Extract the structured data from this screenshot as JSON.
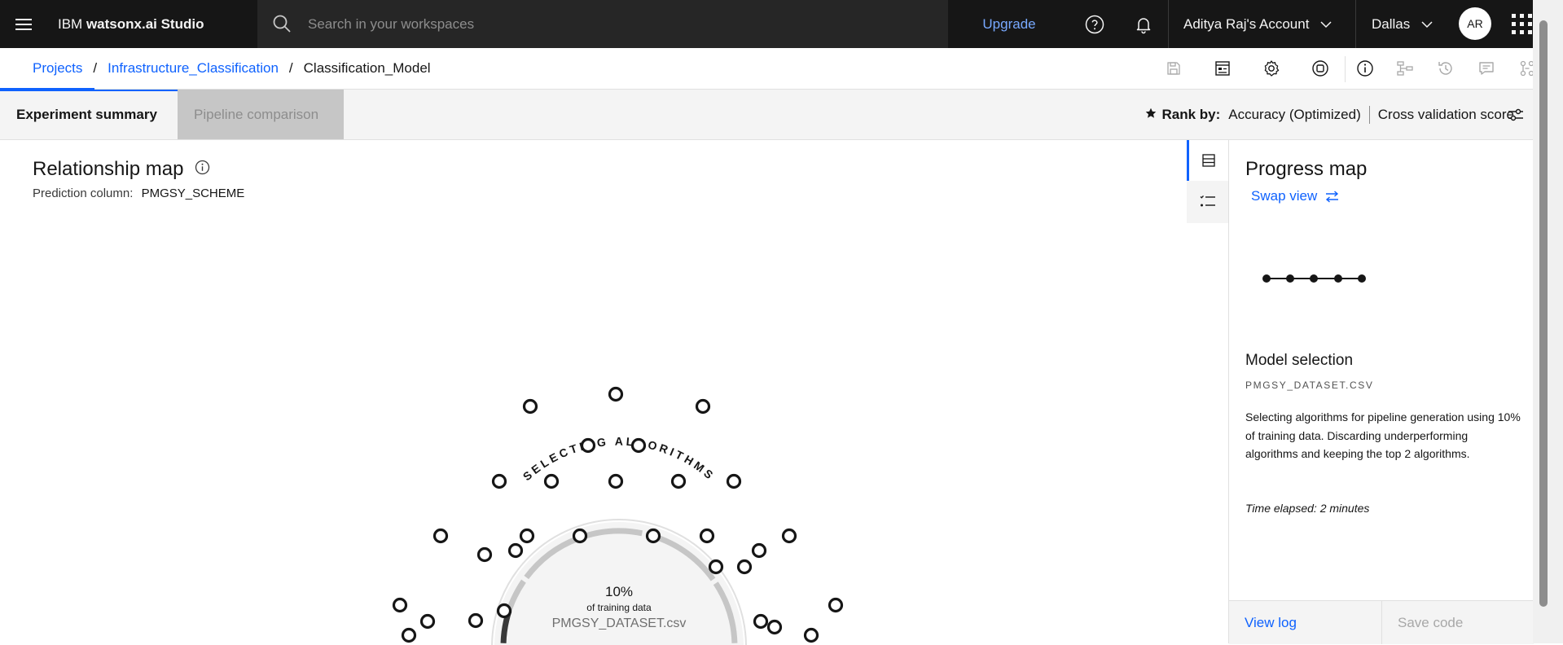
{
  "topnav": {
    "brand_prefix": "IBM ",
    "brand_product": "watsonx.ai Studio",
    "search_placeholder": "Search in your workspaces",
    "upgrade": "Upgrade",
    "account": "Aditya Raj's Account",
    "region": "Dallas",
    "avatar_initials": "AR"
  },
  "breadcrumb": {
    "items": [
      "Projects",
      "Infrastructure_Classification"
    ],
    "current": "Classification_Model"
  },
  "tabs": {
    "active": "Experiment summary",
    "disabled": "Pipeline comparison"
  },
  "rank": {
    "label": "Rank by:",
    "metric": "Accuracy (Optimized)",
    "score_type": "Cross validation score"
  },
  "relationship_map": {
    "title": "Relationship map",
    "prediction_label": "Prediction column:",
    "prediction_value": "PMGSY_SCHEME",
    "stage_text": "SELECTING ALGORITHMS",
    "percent": "10%",
    "percent_caption": "of training data",
    "dataset": "PMGSY_DATASET.csv",
    "progress_fraction": 0.1
  },
  "progress_panel": {
    "title": "Progress map",
    "swap": "Swap view",
    "stage_title": "Model selection",
    "file": "PMGSY_DATASET.CSV",
    "description": "Selecting algorithms for pipeline generation using 10% of training data. Discarding underperforming algorithms and keeping the top 2 algorithms.",
    "time_elapsed": "Time elapsed: 2 minutes",
    "view_log": "View log",
    "save_code": "Save code"
  },
  "colors": {
    "accent": "#0f62fe",
    "nav_bg": "#161616",
    "link_dark": "#78a9ff"
  }
}
